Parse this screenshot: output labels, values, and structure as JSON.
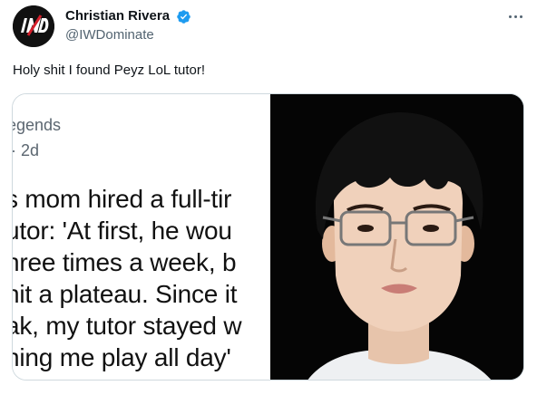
{
  "author": {
    "name": "Christian Rivera",
    "handle": "@IWDominate",
    "avatar_initials": "IWD",
    "verified_color": "#1d9bf0"
  },
  "tweet": {
    "text": "Holy shit I found Peyz LoL tutor!"
  },
  "media": {
    "left_panel": {
      "header": "egends",
      "time": "· 2d",
      "lines": [
        "s mom hired a full-tir",
        "utor: 'At first, he wou",
        "hree times a week, b",
        "hit a plateau. Since it",
        "ak, my tutor stayed w",
        "hing me play all day'"
      ]
    },
    "right_panel": {
      "description_icon": "portrait-photo"
    }
  },
  "icons": {
    "more": "more-horizontal-icon",
    "verified": "verified-badge-icon"
  }
}
